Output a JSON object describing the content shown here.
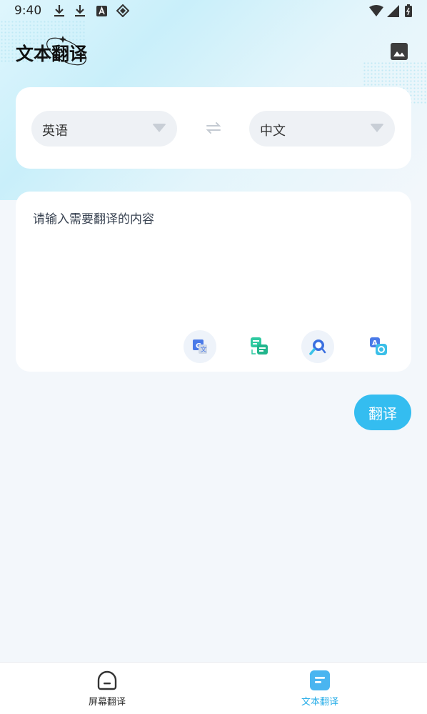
{
  "status_bar": {
    "time": "9:40",
    "icons": [
      "download-icon",
      "download-icon",
      "a-app-icon",
      "tag-icon",
      "wifi-icon",
      "signal-icon",
      "battery-icon"
    ]
  },
  "header": {
    "title": "文本翻译",
    "action_icon": "image-icon"
  },
  "language": {
    "source": "英语",
    "target": "中文",
    "swap_icon": "swap-icon"
  },
  "input": {
    "placeholder": "请输入需要翻译的内容",
    "value": "",
    "tools": [
      "google-translate-icon",
      "chat-translate-icon",
      "search-translate-icon",
      "photo-translate-icon"
    ]
  },
  "actions": {
    "translate_label": "翻译",
    "translate_color": "#34bdf0"
  },
  "bottom_nav": {
    "items": [
      {
        "label": "屏幕翻译",
        "icon": "screen-icon",
        "active": false
      },
      {
        "label": "文本翻译",
        "icon": "text-doc-icon",
        "active": true
      }
    ],
    "active_color": "#2aaee8",
    "inactive_color": "#333333"
  }
}
